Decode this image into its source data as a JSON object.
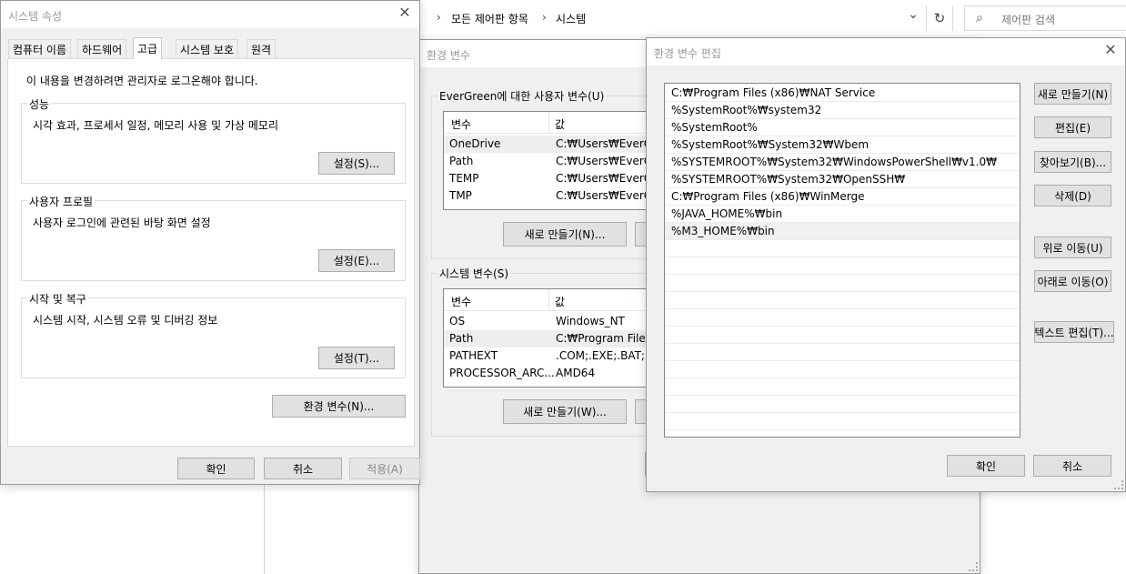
{
  "explorer": {
    "breadcrumb_sep": "›",
    "crumb1": "모든 제어판 항목",
    "crumb2": "시스템",
    "dropdown": "⌄",
    "refresh": "↻",
    "search_icon": "⌕",
    "search_placeholder": "제어판 검색"
  },
  "sysprops": {
    "title": "시스템 속성",
    "close": "✕",
    "tabs": [
      "컴퓨터 이름",
      "하드웨어",
      "고급",
      "시스템 보호",
      "원격"
    ],
    "admin_note": "이 내용을 변경하려면 관리자로 로그온해야 합니다.",
    "perf": {
      "label": "성능",
      "desc": "시각 효과, 프로세서 일정, 메모리 사용 및 가상 메모리",
      "button": "설정(S)..."
    },
    "profile": {
      "label": "사용자 프로필",
      "desc": "사용자 로그인에 관련된 바탕 화면 설정",
      "button": "설정(E)..."
    },
    "startup": {
      "label": "시작 및 복구",
      "desc": "시스템 시작, 시스템 오류 및 디버깅 정보",
      "button": "설정(T)..."
    },
    "env_button": "환경 변수(N)...",
    "ok": "확인",
    "cancel": "취소",
    "apply": "적용(A)"
  },
  "envvars": {
    "title": "환경 변수",
    "user_group": "EverGreen에 대한 사용자 변수(U)",
    "col_var": "변수",
    "col_val": "값",
    "user_vars": [
      {
        "name": "OneDrive",
        "value": "C:₩Users₩EverGreen"
      },
      {
        "name": "Path",
        "value": "C:₩Users₩EverGreen"
      },
      {
        "name": "TEMP",
        "value": "C:₩Users₩EverGreen"
      },
      {
        "name": "TMP",
        "value": "C:₩Users₩EverGreen"
      }
    ],
    "user_new": "새로 만들기(N)...",
    "sys_group": "시스템 변수(S)",
    "sys_vars": [
      {
        "name": "OS",
        "value": "Windows_NT"
      },
      {
        "name": "Path",
        "value": "C:₩Program Files ("
      },
      {
        "name": "PATHEXT",
        "value": ".COM;.EXE;.BAT;.CM"
      },
      {
        "name": "PROCESSOR_ARC...",
        "value": "AMD64"
      }
    ],
    "sys_new": "새로 만들기(W)..."
  },
  "editenv": {
    "title": "환경 변수 편집",
    "close": "✕",
    "paths": [
      "C:₩Program Files (x86)₩NAT Service",
      "%SystemRoot%₩system32",
      "%SystemRoot%",
      "%SystemRoot%₩System32₩Wbem",
      "%SYSTEMROOT%₩System32₩WindowsPowerShell₩v1.0₩",
      "%SYSTEMROOT%₩System32₩OpenSSH₩",
      "C:₩Program Files (x86)₩WinMerge",
      "%JAVA_HOME%₩bin",
      "%M3_HOME%₩bin"
    ],
    "buttons": {
      "new": "새로 만들기(N)",
      "edit": "편집(E)",
      "browse": "찾아보기(B)...",
      "delete": "삭제(D)",
      "up": "위로 이동(U)",
      "down": "아래로 이동(O)",
      "text_edit": "텍스트 편집(T)..."
    },
    "ok": "확인",
    "cancel": "취소"
  }
}
